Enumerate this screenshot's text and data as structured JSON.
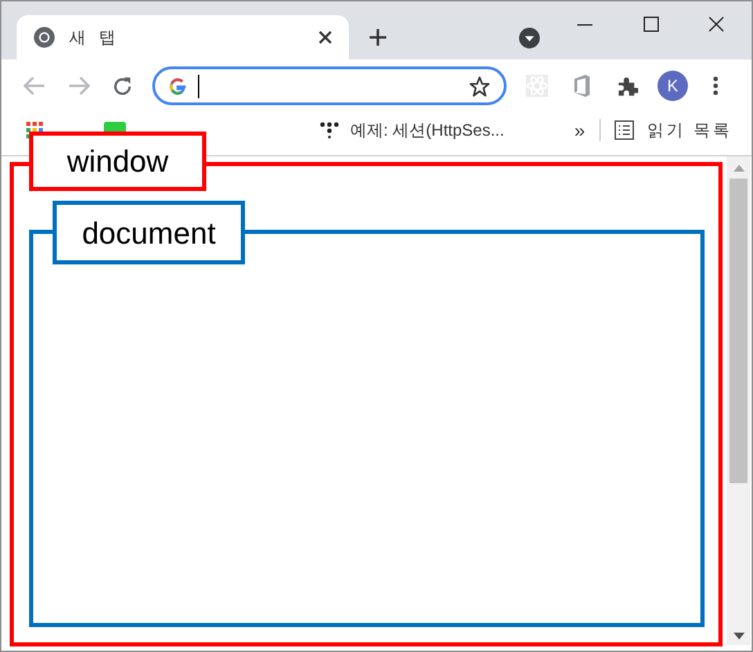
{
  "tab": {
    "title": "새 탭",
    "selected": true
  },
  "bookmarks": [
    {
      "kind": "apps"
    },
    {
      "kind": "green"
    },
    {
      "label": "예제: 세션(HttpSes...",
      "kind": "dots"
    }
  ],
  "more": "»",
  "reading_list": "읽기 목록",
  "profile_initial": "K",
  "annotations": [
    {
      "label": "window",
      "color": "#ff0000"
    },
    {
      "label": "document",
      "color": "#0070c0"
    }
  ]
}
